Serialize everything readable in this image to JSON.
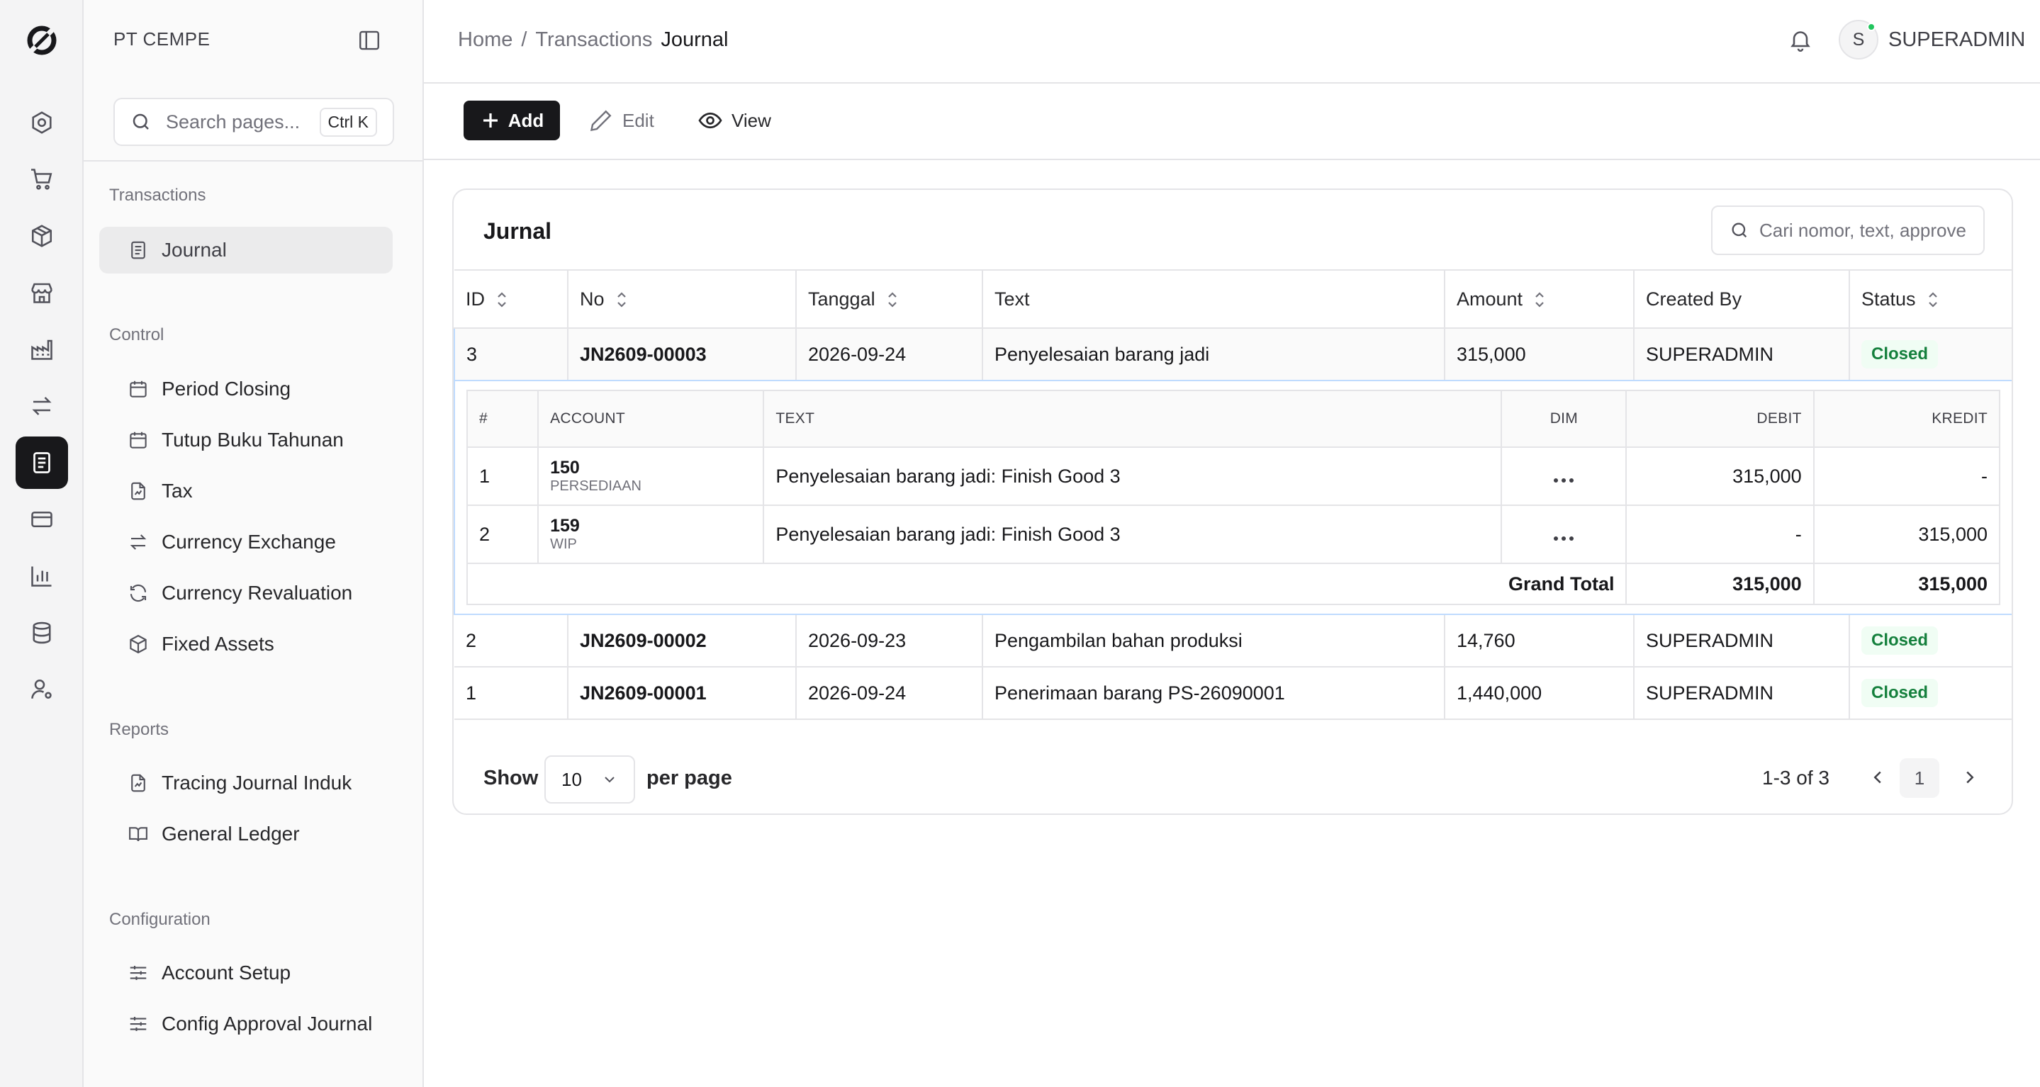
{
  "sidebar": {
    "company": "PT CEMPE",
    "search_placeholder": "Search pages...",
    "search_shortcut": "Ctrl K",
    "groups": [
      {
        "label": "Transactions",
        "items": [
          {
            "label": "Journal",
            "icon": "document-icon",
            "active": true
          }
        ]
      },
      {
        "label": "Control",
        "items": [
          {
            "label": "Period Closing",
            "icon": "calendar-icon"
          },
          {
            "label": "Tutup Buku Tahunan",
            "icon": "calendar-icon"
          },
          {
            "label": "Tax",
            "icon": "file-chart-icon"
          },
          {
            "label": "Currency Exchange",
            "icon": "arrows-exchange-icon"
          },
          {
            "label": "Currency Revaluation",
            "icon": "refresh-icon"
          },
          {
            "label": "Fixed Assets",
            "icon": "box-icon"
          }
        ]
      },
      {
        "label": "Reports",
        "items": [
          {
            "label": "Tracing Journal Induk",
            "icon": "file-chart-icon"
          },
          {
            "label": "General Ledger",
            "icon": "book-icon"
          }
        ]
      },
      {
        "label": "Configuration",
        "items": [
          {
            "label": "Account Setup",
            "icon": "sliders-icon"
          },
          {
            "label": "Config Approval Journal",
            "icon": "sliders-icon"
          }
        ]
      }
    ]
  },
  "header": {
    "breadcrumb": [
      "Home",
      "/",
      "Transactions",
      "Journal"
    ],
    "avatar_initial": "S",
    "user": "SUPERADMIN"
  },
  "toolbar": {
    "add": "Add",
    "edit": "Edit",
    "view": "View"
  },
  "journal": {
    "title": "Jurnal",
    "search_placeholder": "Cari nomor, text, approve",
    "columns": [
      "ID",
      "No",
      "Tanggal",
      "Text",
      "Amount",
      "Created By",
      "Status"
    ],
    "rows": [
      {
        "id": "3",
        "no": "JN2609-00003",
        "tanggal": "2026-09-24",
        "text": "Penyelesaian barang jadi",
        "amount": "315,000",
        "created_by": "SUPERADMIN",
        "status": "Closed"
      },
      {
        "id": "2",
        "no": "JN2609-00002",
        "tanggal": "2026-09-23",
        "text": "Pengambilan bahan produksi",
        "amount": "14,760",
        "created_by": "SUPERADMIN",
        "status": "Closed"
      },
      {
        "id": "1",
        "no": "JN2609-00001",
        "tanggal": "2026-09-24",
        "text": "Penerimaan barang PS-26090001",
        "amount": "1,440,000",
        "created_by": "SUPERADMIN",
        "status": "Closed"
      }
    ],
    "detail": {
      "columns": [
        "#",
        "ACCOUNT",
        "TEXT",
        "DIM",
        "DEBIT",
        "KREDIT"
      ],
      "lines": [
        {
          "n": "1",
          "account": "150",
          "account_name": "PERSEDIAAN",
          "text": "Penyelesaian barang jadi: Finish Good 3",
          "debit": "315,000",
          "kredit": "-"
        },
        {
          "n": "2",
          "account": "159",
          "account_name": "WIP",
          "text": "Penyelesaian barang jadi: Finish Good 3",
          "debit": "-",
          "kredit": "315,000"
        }
      ],
      "total_label": "Grand Total",
      "total_debit": "315,000",
      "total_kredit": "315,000"
    }
  },
  "pagination": {
    "show": "Show",
    "per_page_value": "10",
    "per_page": "per page",
    "range": "1-3 of 3",
    "page": "1"
  },
  "colors": {
    "accent": "#18181b",
    "status_closed_bg": "#f0fdf4",
    "status_closed_text": "#15803d",
    "selected_border": "#bfdbfe"
  }
}
